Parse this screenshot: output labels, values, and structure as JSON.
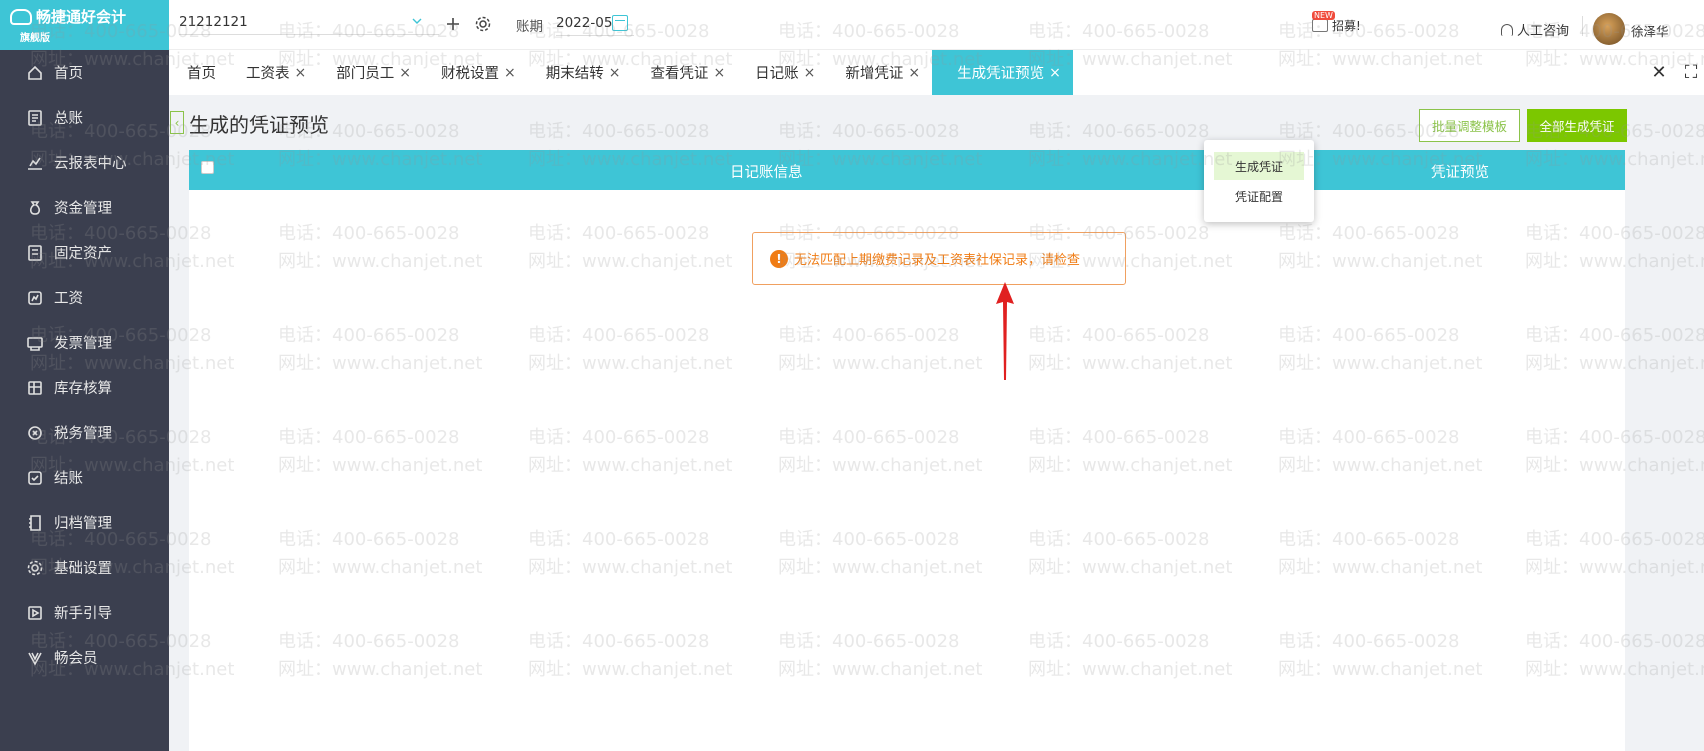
{
  "app": {
    "logo_title": "畅捷通好会计",
    "logo_edition": "旗舰版"
  },
  "sidebar": {
    "items": [
      {
        "label": "首页",
        "icon": "home-icon"
      },
      {
        "label": "总账",
        "icon": "ledger-icon"
      },
      {
        "label": "云报表中心",
        "icon": "chart-icon"
      },
      {
        "label": "资金管理",
        "icon": "money-bag-icon"
      },
      {
        "label": "固定资产",
        "icon": "asset-icon"
      },
      {
        "label": "工资",
        "icon": "salary-icon"
      },
      {
        "label": "发票管理",
        "icon": "invoice-icon"
      },
      {
        "label": "库存核算",
        "icon": "inventory-icon"
      },
      {
        "label": "税务管理",
        "icon": "tax-icon"
      },
      {
        "label": "结账",
        "icon": "checkout-icon"
      },
      {
        "label": "归档管理",
        "icon": "archive-icon"
      },
      {
        "label": "基础设置",
        "icon": "gear-icon"
      },
      {
        "label": "新手引导",
        "icon": "guide-icon"
      },
      {
        "label": "畅会员",
        "icon": "vip-icon"
      }
    ]
  },
  "topbar": {
    "company": "21212121",
    "period_label": "账期",
    "period_value": "2022-05",
    "new_tag": "NEW",
    "recruit_label": "招募!",
    "support_label": "人工咨询",
    "username": "徐泽华"
  },
  "tabs": [
    {
      "label": "首页",
      "closable": false
    },
    {
      "label": "工资表",
      "closable": true
    },
    {
      "label": "部门员工",
      "closable": true
    },
    {
      "label": "财税设置",
      "closable": true
    },
    {
      "label": "期末结转",
      "closable": true
    },
    {
      "label": "查看凭证",
      "closable": true
    },
    {
      "label": "日记账",
      "closable": true
    },
    {
      "label": "新增凭证",
      "closable": true
    },
    {
      "label": "生成凭证预览",
      "closable": true,
      "active": true
    }
  ],
  "main": {
    "page_title": "生成的凭证预览",
    "btn_batch_template": "批量调整模板",
    "btn_generate_all": "全部生成凭证",
    "table_headers": {
      "journal_info": "日记账信息",
      "voucher_preview": "凭证预览"
    },
    "dropdown": [
      "生成凭证",
      "凭证配置"
    ],
    "alert_message": "无法匹配上期缴费记录及工资表社保记录，请检查"
  },
  "watermark": {
    "phone": "电话：400-665-0028",
    "site": "网址：www.chanjet.net"
  },
  "colors": {
    "accent": "#3ec5d6",
    "sidebar_bg": "#3b3f4f",
    "green": "#7cc700",
    "warning": "#f07c14",
    "arrow": "#e02020"
  }
}
